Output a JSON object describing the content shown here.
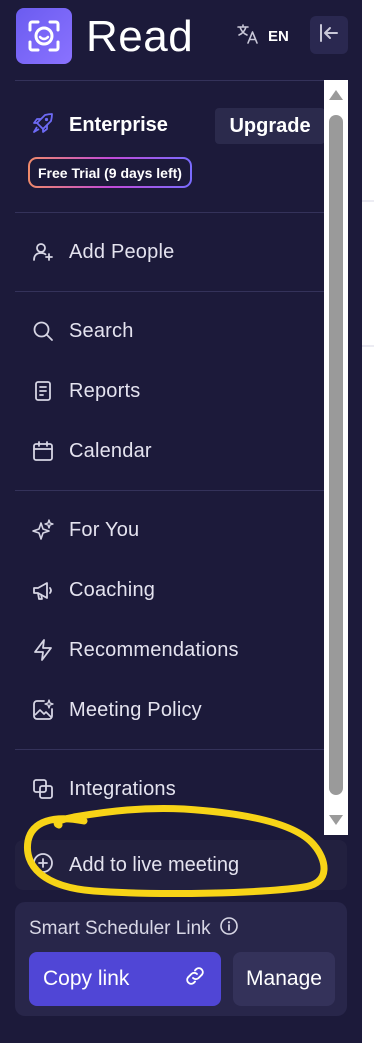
{
  "header": {
    "brand": "Read",
    "language_code": "EN",
    "logo_icon": "read-logo-icon",
    "translate_icon": "translate-icon",
    "collapse_icon": "collapse-sidebar-icon"
  },
  "plan": {
    "name": "Enterprise",
    "upgrade_label": "Upgrade",
    "trial_badge": "Free Trial (9 days left)",
    "icon": "rocket-icon"
  },
  "nav": {
    "add_people": "Add People",
    "search": "Search",
    "reports": "Reports",
    "calendar": "Calendar",
    "for_you": "For You",
    "coaching": "Coaching",
    "recommendations": "Recommendations",
    "meeting_policy": "Meeting Policy",
    "integrations": "Integrations"
  },
  "live_meeting": {
    "label": "Add to live meeting"
  },
  "scheduler": {
    "title": "Smart Scheduler Link",
    "copy_label": "Copy link",
    "manage_label": "Manage"
  },
  "colors": {
    "background": "#1c1a3a",
    "accent": "#5046d6",
    "highlight": "#f7d417"
  }
}
